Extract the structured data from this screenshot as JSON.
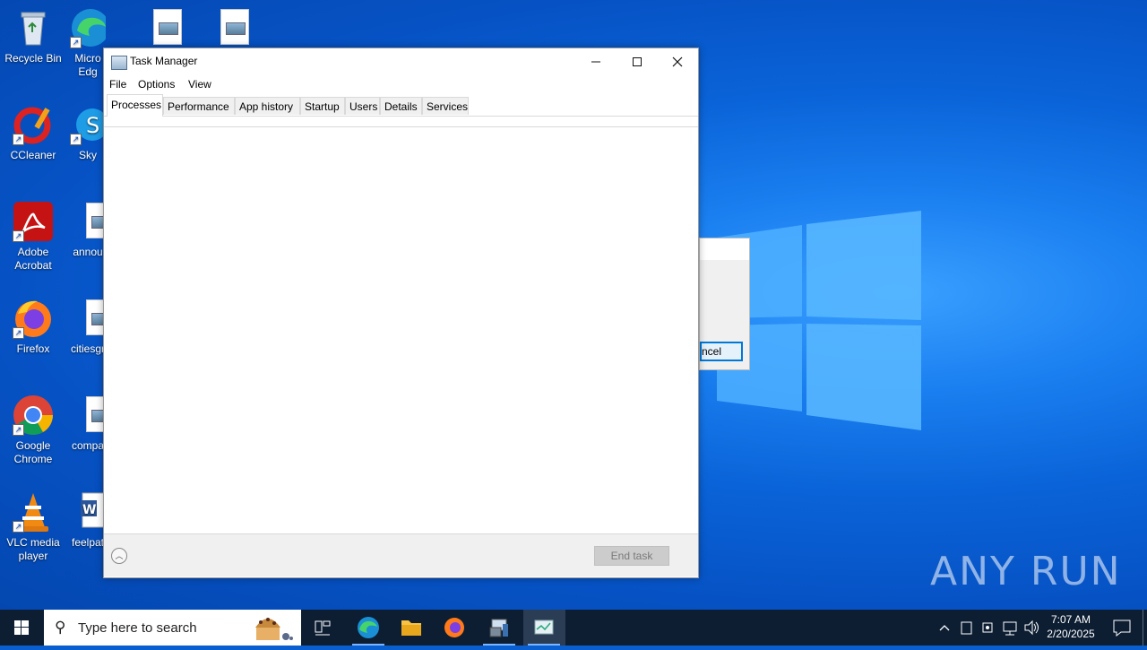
{
  "desktop": {
    "icons": [
      {
        "label": "Recycle Bin"
      },
      {
        "label": "Micro Edg"
      },
      {
        "label": "CCleaner"
      },
      {
        "label": "Sky"
      },
      {
        "label": "Adobe Acrobat"
      },
      {
        "label": "annou"
      },
      {
        "label": "Firefox"
      },
      {
        "label": "citiesgr"
      },
      {
        "label": "Google Chrome"
      },
      {
        "label": "compa"
      },
      {
        "label": "VLC media player"
      },
      {
        "label": "feelpat"
      }
    ]
  },
  "background_dialog": {
    "button_label": "ncel"
  },
  "task_manager": {
    "title": "Task Manager",
    "menu": [
      "File",
      "Options",
      "View"
    ],
    "tabs": [
      "Processes",
      "Performance",
      "App history",
      "Startup",
      "Users",
      "Details",
      "Services"
    ],
    "active_tab": "Processes",
    "end_task_label": "End task"
  },
  "taskbar": {
    "search_placeholder": "Type here to search",
    "time": "7:07 AM",
    "date": "2/20/2025"
  },
  "watermark": "ANY RUN"
}
